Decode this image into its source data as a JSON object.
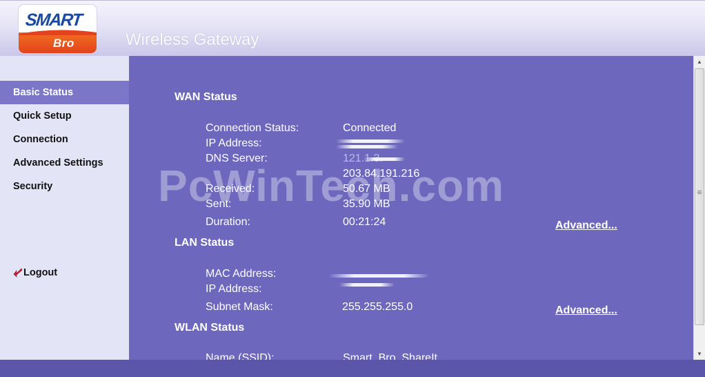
{
  "header": {
    "logo_main": "SMART",
    "logo_sub": "Bro",
    "title": "Wireless Gateway"
  },
  "sidebar": {
    "items": [
      {
        "label": "Basic Status",
        "active": true
      },
      {
        "label": "Quick Setup",
        "active": false
      },
      {
        "label": "Connection",
        "active": false
      },
      {
        "label": "Advanced Settings",
        "active": false
      },
      {
        "label": "Security",
        "active": false
      }
    ],
    "logout_label": "Logout",
    "logout_icon": "red-arrow-icon"
  },
  "wan": {
    "title": "WAN Status",
    "connection_status_label": "Connection Status:",
    "connection_status_value": "Connected",
    "ip_label": "IP Address:",
    "dns_label": "DNS Server:",
    "dns_primary_partial": "121.1.3.",
    "dns_secondary": "203.84.191.216",
    "received_label": "Received:",
    "received_value": "50.67 MB",
    "sent_label": "Sent:",
    "sent_value": "35.90 MB",
    "duration_label": "Duration:",
    "duration_value": "00:21:24",
    "advanced_link": "Advanced..."
  },
  "lan": {
    "title": "LAN Status",
    "mac_label": "MAC Address:",
    "ip_label": "IP Address:",
    "subnet_label": "Subnet Mask:",
    "subnet_value": "255.255.255.0",
    "advanced_link": "Advanced..."
  },
  "wlan": {
    "title": "WLAN Status",
    "ssid_label": "Name (SSID):",
    "ssid_value": "Smart_Bro_ShareIt"
  },
  "watermark": "PcWinTech.com",
  "colors": {
    "content_bg": "#6d68be",
    "sidebar_bg": "#e4e4f7",
    "active_item_bg": "#7b76c7",
    "logo_orange": "#e2431c",
    "logo_blue": "#1a4aa0"
  }
}
